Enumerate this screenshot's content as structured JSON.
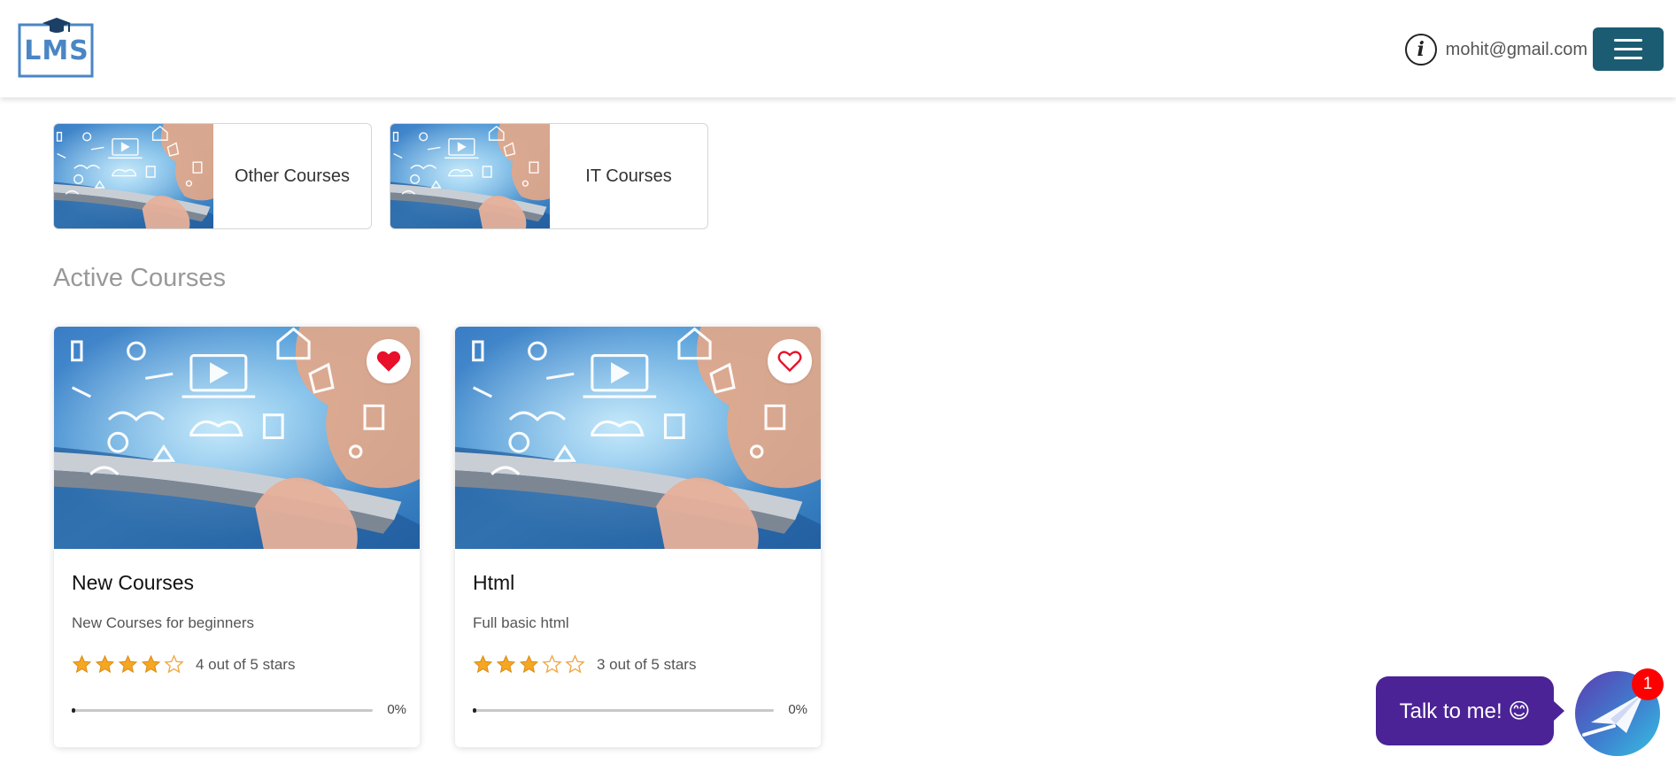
{
  "header": {
    "logo_text": "LMS",
    "user_email": "mohit@gmail.com",
    "info_icon": "info-icon",
    "menu_icon": "hamburger-menu-icon"
  },
  "categories": [
    {
      "label": "Other Courses"
    },
    {
      "label": "IT Courses"
    }
  ],
  "section_title": "Active Courses",
  "courses": [
    {
      "title": "New Courses",
      "description": "New Courses for beginners",
      "rating": 4,
      "rating_max": 5,
      "rating_text": "4 out of 5 stars",
      "progress": 0,
      "progress_text": "0%",
      "favorite": true
    },
    {
      "title": "Html",
      "description": "Full basic html",
      "rating": 3,
      "rating_max": 5,
      "rating_text": "3 out of 5 stars",
      "progress": 0,
      "progress_text": "0%",
      "favorite": false
    }
  ],
  "chat": {
    "label": "Talk to me! 😊",
    "badge_count": "1"
  },
  "colors": {
    "brand": "#1b5c72",
    "logo": "#4a86c5",
    "favorite": "#e8102a",
    "star": "#f5a623",
    "chat": "#4b2396",
    "badge": "#ff0000"
  }
}
